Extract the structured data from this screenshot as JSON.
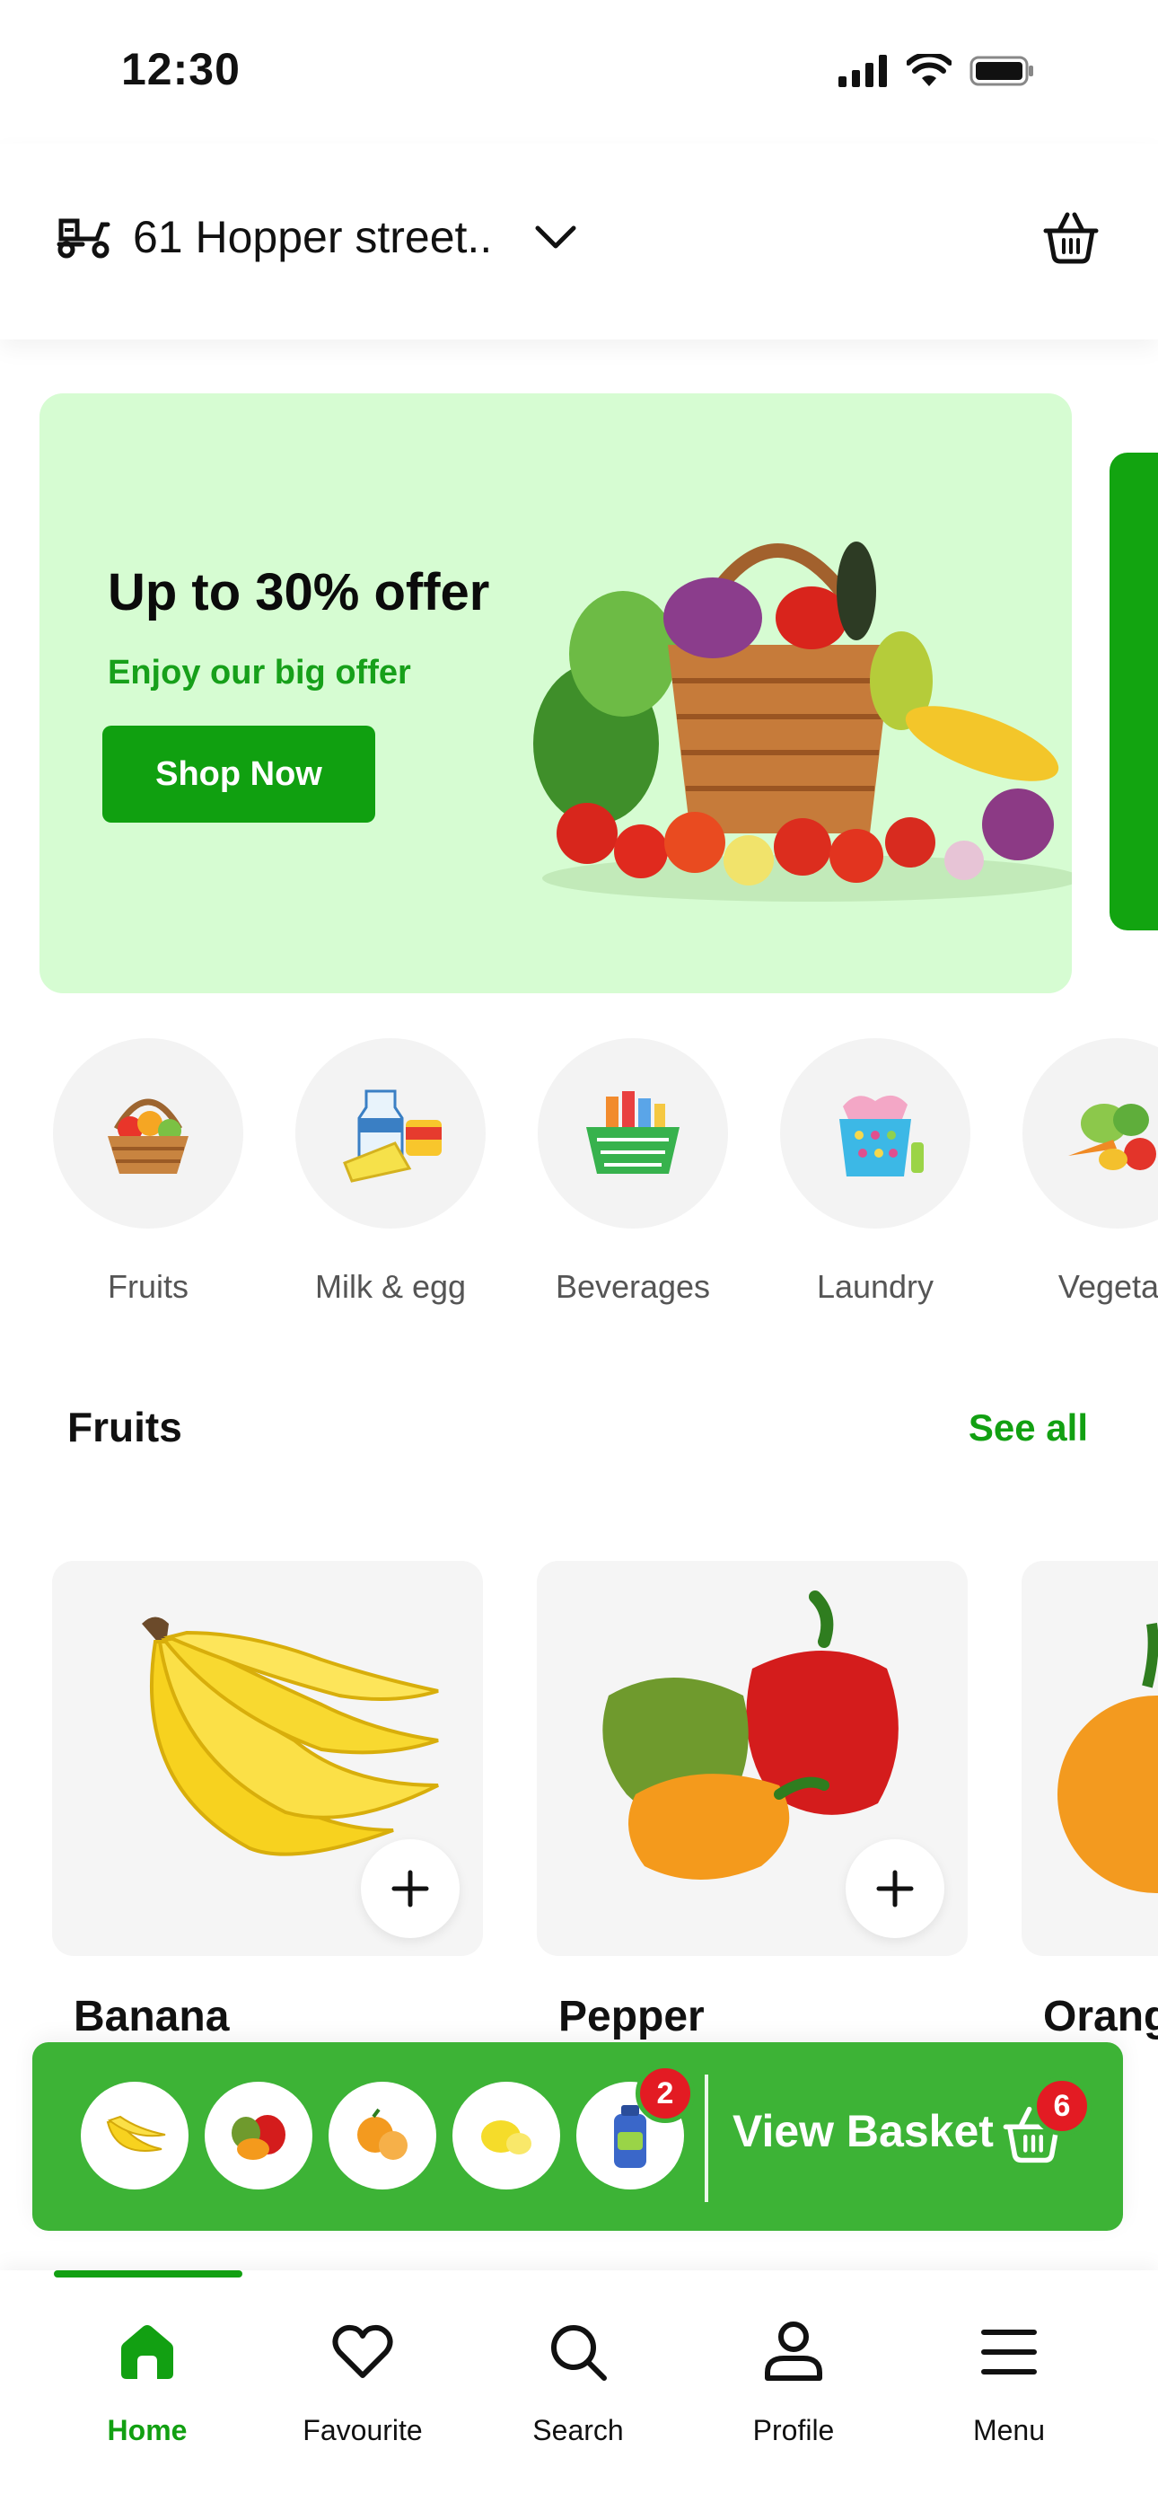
{
  "status_bar": {
    "time": "12:30"
  },
  "header": {
    "location": "61 Hopper street.."
  },
  "banner": {
    "title": "Up to 30% offer",
    "subtitle": "Enjoy our big offer",
    "button": "Shop Now"
  },
  "categories": [
    {
      "label": "Fruits"
    },
    {
      "label": "Milk & egg"
    },
    {
      "label": "Beverages"
    },
    {
      "label": "Laundry"
    },
    {
      "label": "Vegetab"
    }
  ],
  "section": {
    "title": "Fruits",
    "see_all": "See all"
  },
  "products": [
    {
      "name": "Banana"
    },
    {
      "name": "Pepper"
    },
    {
      "name": "Orang"
    }
  ],
  "basket_bar": {
    "label": "View Basket",
    "item_badge": "2",
    "cart_badge": "6"
  },
  "nav": [
    {
      "label": "Home",
      "active": true
    },
    {
      "label": "Favourite"
    },
    {
      "label": "Search"
    },
    {
      "label": "Profile"
    },
    {
      "label": "Menu"
    }
  ],
  "colors": {
    "brand": "#12a012",
    "banner_bg": "#d6fcd2",
    "basket_bar": "#3db336",
    "badge": "#e31b23"
  }
}
